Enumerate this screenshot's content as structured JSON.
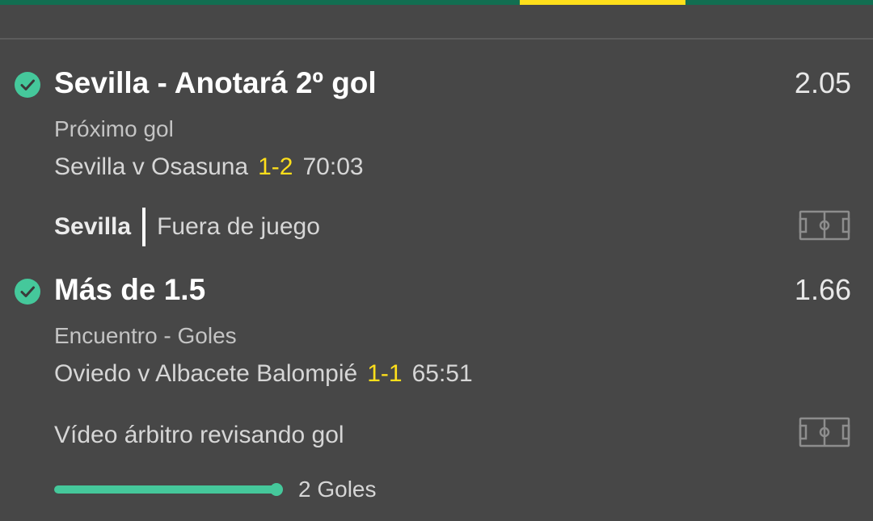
{
  "colors": {
    "background": "#474747",
    "topbar": "#126e51",
    "tab_indicator": "#ffdf1b",
    "score": "#ffdf1b",
    "success": "#45c89b"
  },
  "bets": [
    {
      "status_icon": "check-circle-icon",
      "selection": "Sevilla - Anotará 2º gol",
      "odds": "2.05",
      "market": "Próximo gol",
      "event": "Sevilla v Osasuna",
      "score": "1-2",
      "clock": "70:03",
      "incident_team": "Sevilla",
      "incident": "Fuera de juego",
      "incident_icon": "football-pitch-icon"
    },
    {
      "status_icon": "check-circle-icon",
      "selection": "Más de 1.5",
      "odds": "1.66",
      "market": "Encuentro - Goles",
      "event": "Oviedo v Albacete Balompié",
      "score": "1-1",
      "clock": "65:51",
      "incident": "Vídeo árbitro revisando gol",
      "incident_icon": "football-pitch-icon",
      "progress": {
        "fraction": 1.0,
        "label": "2 Goles"
      }
    }
  ]
}
